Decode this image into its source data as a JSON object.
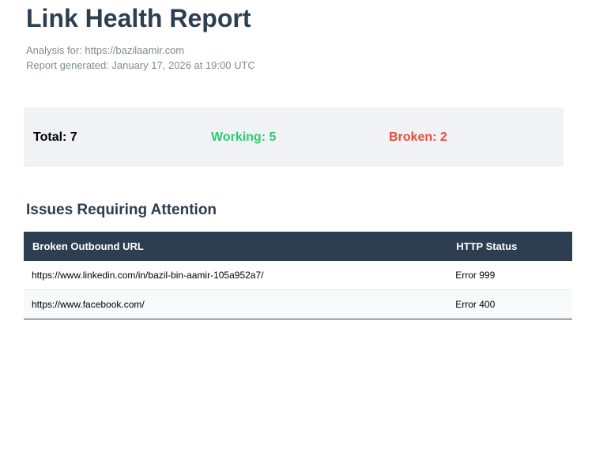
{
  "report": {
    "title": "Link Health Report",
    "analysis_line": "Analysis for: https://bazilaamir.com",
    "generated_line": "Report generated: January 17, 2026 at 19:00 UTC"
  },
  "summary": {
    "total": "Total: 7",
    "working": "Working: 5",
    "broken": "Broken: 2"
  },
  "issues": {
    "heading": "Issues Requiring Attention",
    "columns": {
      "url": "Broken Outbound URL",
      "status": "HTTP Status"
    },
    "rows": [
      {
        "url": "https://www.linkedin.com/in/bazil-bin-aamir-105a952a7/",
        "status": "Error 999"
      },
      {
        "url": "https://www.facebook.com/",
        "status": "Error 400"
      }
    ]
  },
  "colors": {
    "primary": "#2c3e50",
    "working": "#2ecc71",
    "broken": "#e74c3c",
    "muted": "#7f8c8d",
    "summary_bg": "#f1f2f5"
  }
}
